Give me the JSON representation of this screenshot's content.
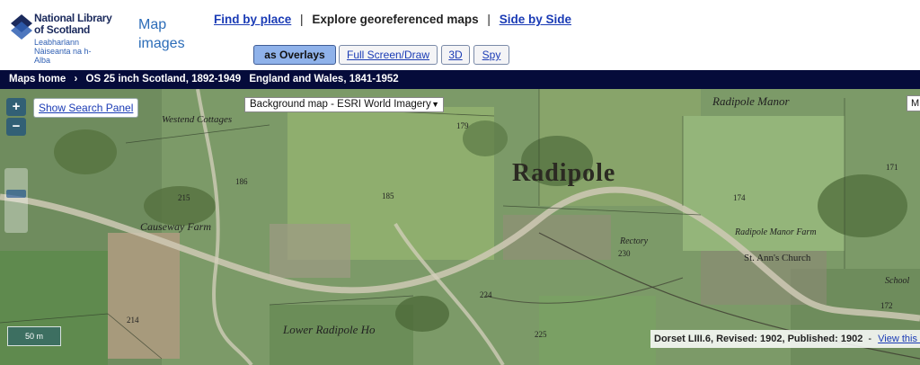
{
  "logo": {
    "title": "National Library of Scotland",
    "gaelic": "Leabharlann Nàiseanta na h-Alba",
    "brand_color": "#1b2a5c"
  },
  "site_title": "Map images",
  "topnav": {
    "find_by_place": "Find by place",
    "explore": "Explore georeferenced maps",
    "side_by_side": "Side by Side",
    "separator": "|"
  },
  "modes": {
    "overlays": "as Overlays",
    "fullscreen": "Full Screen/Draw",
    "three_d": "3D",
    "spy": "Spy"
  },
  "breadcrumb": {
    "home": "Maps home",
    "arrow": "›",
    "series": "OS 25 inch Scotland, 1892-1949",
    "series2": "England and Wales, 1841-1952"
  },
  "map": {
    "zoom_in": "+",
    "zoom_out": "−",
    "show_search_panel": "Show Search Panel",
    "background_select": "Background map - ESRI World Imagery",
    "right_control": "M",
    "scale": "50 m",
    "sheet_info": "Dorset LIII.6, Revised: 1902, Published: 1902",
    "sheet_separator": "-",
    "view_link": "View this map",
    "labels": {
      "radipole": "Radipole",
      "radipole_manor": "Radipole Manor",
      "radipole_manor_farm": "Radipole Manor Farm",
      "westend_cottages": "Westend Cottages",
      "causeway_farm": "Causeway Farm",
      "lower_radipole": "Lower Radipole Ho",
      "st_anns_church": "St. Ann's Church",
      "rectory": "Rectory",
      "school": "School",
      "parcel_179": "179",
      "parcel_185": "185",
      "parcel_186": "186",
      "parcel_215": "215",
      "parcel_214": "214",
      "parcel_224": "224",
      "parcel_225": "225",
      "parcel_230": "230",
      "parcel_174": "174",
      "parcel_171": "171",
      "parcel_172": "172"
    }
  }
}
